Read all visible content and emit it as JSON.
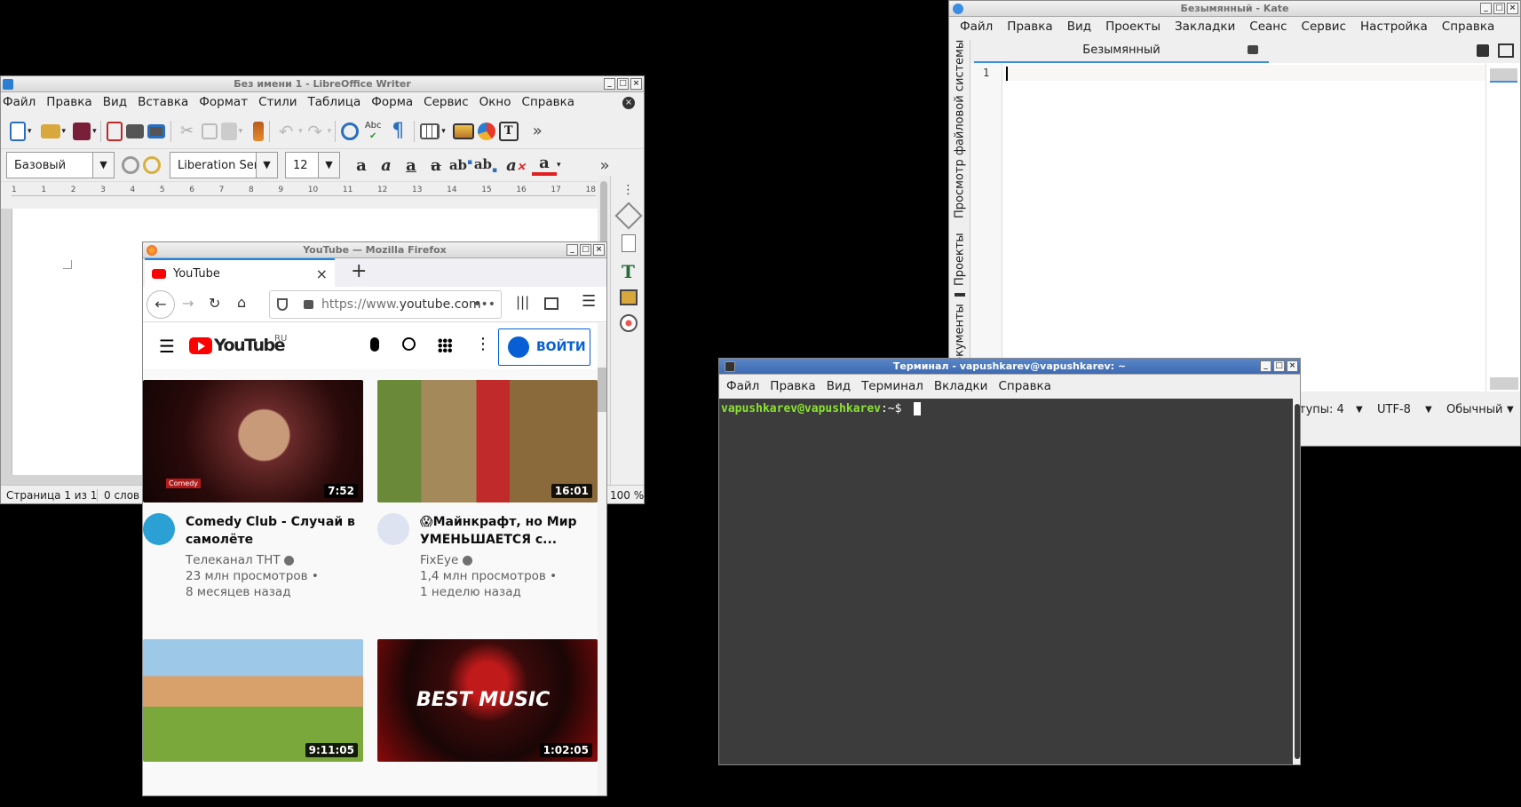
{
  "writer": {
    "title": "Без имени 1 - LibreOffice Writer",
    "menu": [
      "Файл",
      "Правка",
      "Вид",
      "Вставка",
      "Формат",
      "Стили",
      "Таблица",
      "Форма",
      "Сервис",
      "Окно",
      "Справка"
    ],
    "style": "Базовый",
    "font": "Liberation Serif",
    "size": "12",
    "ruler": [
      "1",
      "1",
      "2",
      "3",
      "4",
      "5",
      "6",
      "7",
      "8",
      "9",
      "10",
      "11",
      "12",
      "13",
      "14",
      "15",
      "16",
      "17",
      "18"
    ],
    "status_page": "Страница 1 из 1",
    "status_words": "0 слов",
    "zoom": "100 %"
  },
  "firefox": {
    "title": "YouTube — Mozilla Firefox",
    "tab_label": "YouTube",
    "url_prefix": "https://www.",
    "url_domain": "youtube.com",
    "yt_logo": "YouTube",
    "yt_region": "RU",
    "signin": "ВОЙТИ",
    "videos": [
      {
        "title": "Comedy Club - Случай в самолёте",
        "channel": "Телеканал ТНТ",
        "views": "23 млн просмотров •",
        "age": "8 месяцев назад",
        "duration": "7:52"
      },
      {
        "title": "😱Майнкрафт, но Мир УМЕНЬШАЕТСЯ с...",
        "channel": "FixEye",
        "views": "1,4 млн просмотров •",
        "age": "1 неделю назад",
        "duration": "16:01"
      },
      {
        "title": "",
        "channel": "",
        "views": "",
        "age": "",
        "duration": "9:11:05"
      },
      {
        "title": "",
        "channel": "",
        "views": "",
        "age": "",
        "duration": "1:02:05"
      }
    ],
    "thumb3_text": "BEST MUSIC",
    "thumb1_tag": "Comedy"
  },
  "kate": {
    "title": "Безымянный  - Kate",
    "menu": [
      "Файл",
      "Правка",
      "Вид",
      "Проекты",
      "Закладки",
      "Сеанс",
      "Сервис",
      "Настройка",
      "Справка"
    ],
    "tab": "Безымянный",
    "side_tabs": [
      "Документы",
      "Проекты",
      "Просмотр файловой системы"
    ],
    "line_no": "1",
    "status_indent": "тупы: 4",
    "status_encoding": "UTF-8",
    "status_mode": "Обычный"
  },
  "terminal": {
    "title": "Терминал - vapushkarev@vapushkarev: ~",
    "menu": [
      "Файл",
      "Правка",
      "Вид",
      "Терминал",
      "Вкладки",
      "Справка"
    ],
    "prompt_user": "vapushkarev@vapushkarev",
    "prompt_path": ":~$"
  },
  "colors": {
    "yt_red": "#ff0000",
    "yt_blue": "#065fd4",
    "term_bg": "#3c3c3c",
    "term_prompt": "#8ae234"
  }
}
